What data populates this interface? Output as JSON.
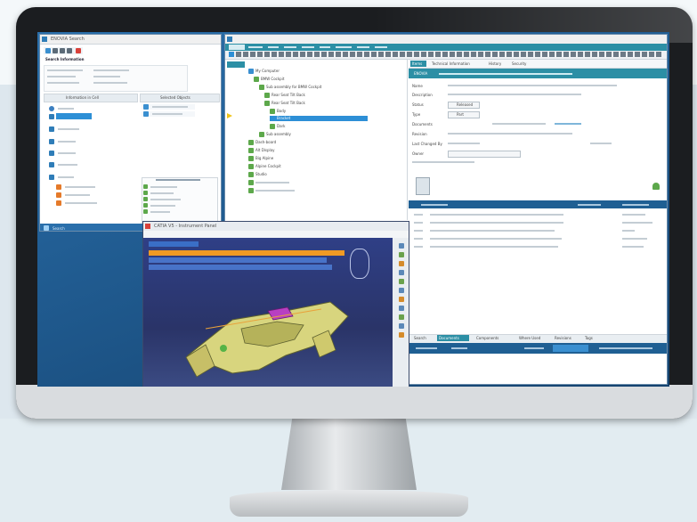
{
  "colors": {
    "accent": "#2c8fa5",
    "selection": "#2d8fd6",
    "catia_bg": "#2c3a7a",
    "orange_highlight": "#f09a24",
    "tree_green": "#5da84b"
  },
  "left_window": {
    "title": "ENOVIA Search",
    "header": "Search Information",
    "tabs": [
      "Information in Cell",
      "Selected Objects"
    ],
    "bottom_label": "Search"
  },
  "tree_window": {
    "tree": [
      "My Computer",
      "BMW Cockpit",
      "BMW Cockpit",
      "Sub assembly for BMW Cockpit",
      "Rear Seat Tilt Back",
      "Rear Seat Tilt Back",
      "Body",
      "Bracket",
      "Dark",
      "Dash-board",
      "Sub assembly",
      "Alt Display",
      "Big Alpine",
      "Alpine Cockpit",
      "Studio"
    ]
  },
  "properties": {
    "header": "ENOVIA",
    "tabs": [
      "Items",
      "Technical Information",
      "History",
      "Security"
    ],
    "fields": [
      "Name",
      "Description",
      "Status",
      "Type",
      "Revision",
      "Last Changed By",
      "Owner",
      "Documents"
    ],
    "values": [
      "Released",
      "Part",
      "A.1"
    ]
  },
  "catia": {
    "title": "CATIA V5 - Instrument Panel",
    "highlight_rows": 3
  },
  "bottom_tabs": [
    "Search",
    "Documents",
    "Components",
    "Where Used",
    "Revisions",
    "Tags"
  ],
  "table": {
    "headers": [
      "Name",
      "Revision",
      "Type"
    ],
    "rows": 5
  },
  "icons": [
    "search-icon",
    "folder-icon",
    "gear-icon",
    "user-icon",
    "part-icon",
    "document-icon",
    "close-icon",
    "save-icon"
  ]
}
